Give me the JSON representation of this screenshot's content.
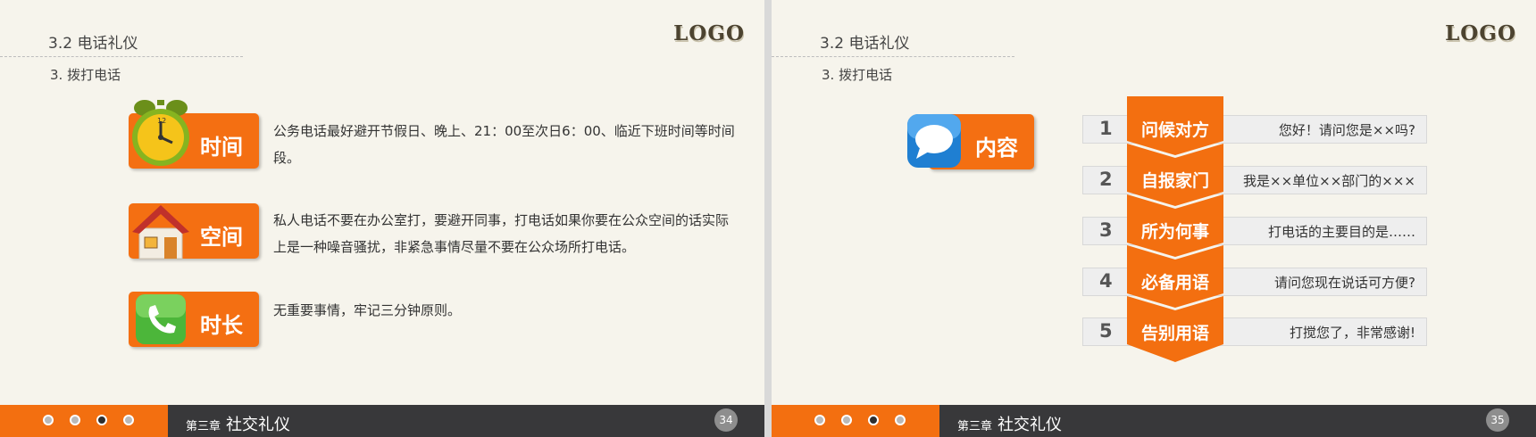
{
  "slides": [
    {
      "section_title": "3.2  电话礼仪",
      "subtitle": "3. 拨打电话",
      "logo": "LOGO",
      "items": [
        {
          "label": "时间",
          "icon": "alarm-clock-icon",
          "text": "公务电话最好避开节假日、晚上、21：00至次日6：00、临近下班时间等时间段。"
        },
        {
          "label": "空间",
          "icon": "house-icon",
          "text": "私人电话不要在办公室打，要避开同事，打电话如果你要在公众空间的话实际上是一种噪音骚扰，非紧急事情尽量不要在公众场所打电话。"
        },
        {
          "label": "时长",
          "icon": "phone-icon",
          "text": "无重要事情，牢记三分钟原则。"
        }
      ],
      "footer": {
        "chapter_prefix": "第三章",
        "chapter_title": "社交礼仪",
        "page": "34",
        "active_dot": 3
      }
    },
    {
      "section_title": "3.2  电话礼仪",
      "subtitle": "3. 拨打电话",
      "logo": "LOGO",
      "content_label": "内容",
      "content_icon": "speech-bubble-icon",
      "steps": [
        {
          "num": "1",
          "title": "问候对方",
          "text": "您好！请问您是××吗?"
        },
        {
          "num": "2",
          "title": "自报家门",
          "text": "我是××单位××部门的×××"
        },
        {
          "num": "3",
          "title": "所为何事",
          "text": "打电话的主要目的是……"
        },
        {
          "num": "4",
          "title": "必备用语",
          "text": "请问您现在说话可方便?"
        },
        {
          "num": "5",
          "title": "告别用语",
          "text": "打搅您了，非常感谢!"
        }
      ],
      "footer": {
        "chapter_prefix": "第三章",
        "chapter_title": "社交礼仪",
        "page": "35",
        "active_dot": 3
      }
    }
  ],
  "colors": {
    "accent": "#f36f10",
    "footer_dark": "#38383a",
    "background": "#f6f4ec"
  }
}
